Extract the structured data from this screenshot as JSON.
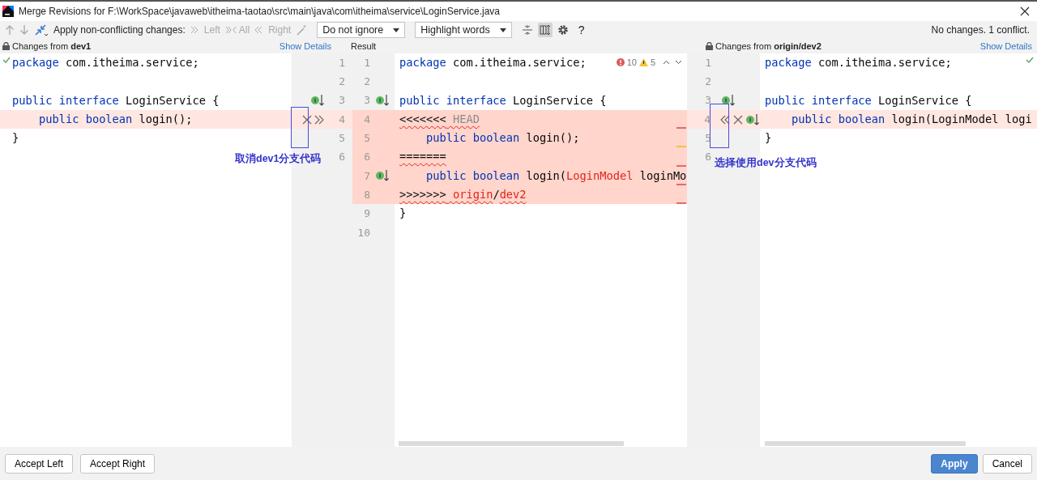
{
  "window": {
    "title": "Merge Revisions for F:\\WorkSpace\\javaweb\\itheima-taotao\\src\\main\\java\\com\\itheima\\service\\LoginService.java"
  },
  "toolbar": {
    "apply_label": "Apply non-conflicting changes:",
    "apply_buttons": [
      {
        "label": "Left",
        "kind": "left",
        "disabled": true
      },
      {
        "label": "All",
        "kind": "all",
        "disabled": true
      },
      {
        "label": "Right",
        "kind": "right",
        "disabled": true
      }
    ],
    "ignore_dropdown": "Do not ignore",
    "highlight_dropdown": "Highlight words",
    "side_by_side_selected": true,
    "help": "?",
    "status": "No changes. 1 conflict."
  },
  "left": {
    "header_prefix": "Changes from ",
    "branch": "dev1",
    "show_details": "Show Details",
    "lines": [
      {
        "number": "1",
        "code": [
          {
            "t": "package",
            "kind": "keyword"
          },
          {
            "t": " com.itheima.service;",
            "kind": "plain"
          }
        ]
      },
      {
        "number": "2"
      },
      {
        "number": "3",
        "code": [
          {
            "t": "public interface",
            "kind": "keyword"
          },
          {
            "t": " LoginService {",
            "kind": "plain"
          }
        ],
        "markers": [
          {
            "kind": "inspect"
          }
        ]
      },
      {
        "number": "4",
        "code": [
          {
            "t": "    public boolean",
            "kind": "keyword"
          },
          {
            "t": " login();",
            "kind": "plain"
          }
        ],
        "changed": true,
        "markers": [
          {
            "kind": "reject"
          },
          {
            "kind": "accept_right"
          }
        ]
      },
      {
        "number": "5",
        "code": [
          {
            "t": "}",
            "kind": "plain"
          }
        ]
      },
      {
        "number": "6"
      }
    ]
  },
  "result": {
    "header": "Result",
    "errors": "10",
    "warnings": "5",
    "lines": [
      {
        "number": "1",
        "code": [
          {
            "t": "package",
            "kind": "keyword"
          },
          {
            "t": " com.itheima.service;",
            "kind": "plain"
          }
        ]
      },
      {
        "number": "2"
      },
      {
        "number": "3",
        "code": [
          {
            "t": "public interface",
            "kind": "keyword"
          },
          {
            "t": " LoginService {",
            "kind": "plain"
          }
        ],
        "markers": [
          {
            "kind": "inspect"
          }
        ]
      },
      {
        "number": "4",
        "code": [
          {
            "t": "<<<<<<<",
            "kind": "error"
          },
          {
            "t": " HEAD",
            "kind": "dim_error"
          }
        ],
        "conflict": true,
        "error": true
      },
      {
        "number": "5",
        "code": [
          {
            "t": "    public boolean",
            "kind": "keyword"
          },
          {
            "t": " login();",
            "kind": "plain"
          }
        ],
        "conflict": true,
        "warning": true
      },
      {
        "number": "6",
        "code": [
          {
            "t": "=======",
            "kind": "error"
          }
        ],
        "conflict": true,
        "error": true
      },
      {
        "number": "7",
        "code": [
          {
            "t": "    public boolean",
            "kind": "keyword"
          },
          {
            "t": " login(",
            "kind": "plain"
          },
          {
            "t": "LoginModel",
            "kind": "red"
          },
          {
            "t": " loginMo",
            "kind": "plain"
          }
        ],
        "conflict": true,
        "markers": [
          {
            "kind": "inspect"
          }
        ],
        "error": true
      },
      {
        "number": "8",
        "code": [
          {
            "t": ">>>>>>>",
            "kind": "error"
          },
          {
            "t": " origin",
            "kind": "red_error"
          },
          {
            "t": "/",
            "kind": "plain"
          },
          {
            "t": "dev2",
            "kind": "red_error"
          }
        ],
        "conflict": true,
        "error": true
      },
      {
        "number": "9",
        "code": [
          {
            "t": "}",
            "kind": "plain"
          }
        ]
      },
      {
        "number": "10"
      }
    ]
  },
  "right": {
    "header_prefix": "Changes from ",
    "branch": "origin/dev2",
    "show_details": "Show Details",
    "lines": [
      {
        "number": "1",
        "code": [
          {
            "t": "package",
            "kind": "keyword"
          },
          {
            "t": " com.itheima.service;",
            "kind": "plain"
          }
        ]
      },
      {
        "number": "2"
      },
      {
        "number": "3",
        "code": [
          {
            "t": "public interface",
            "kind": "keyword"
          },
          {
            "t": " LoginService {",
            "kind": "plain"
          }
        ],
        "markers": [
          {
            "kind": "inspect"
          }
        ]
      },
      {
        "number": "4",
        "code": [
          {
            "t": "    public boolean",
            "kind": "keyword"
          },
          {
            "t": " login(LoginModel logi",
            "kind": "plain"
          }
        ],
        "changed": true,
        "markers": [
          {
            "kind": "accept_left"
          },
          {
            "kind": "reject"
          },
          {
            "kind": "inspect"
          }
        ]
      },
      {
        "number": "5",
        "code": [
          {
            "t": "}",
            "kind": "plain"
          }
        ]
      },
      {
        "number": "6"
      }
    ]
  },
  "annotations": [
    {
      "text": "取消dev1分支代码"
    },
    {
      "text": "选择使用dev分支代码"
    }
  ],
  "footer": {
    "buttons": [
      {
        "label": "Accept Left",
        "kind": "plain"
      },
      {
        "label": "Accept Right",
        "kind": "plain"
      },
      {
        "label": "Apply",
        "kind": "primary"
      },
      {
        "label": "Cancel",
        "kind": "plain"
      }
    ]
  }
}
